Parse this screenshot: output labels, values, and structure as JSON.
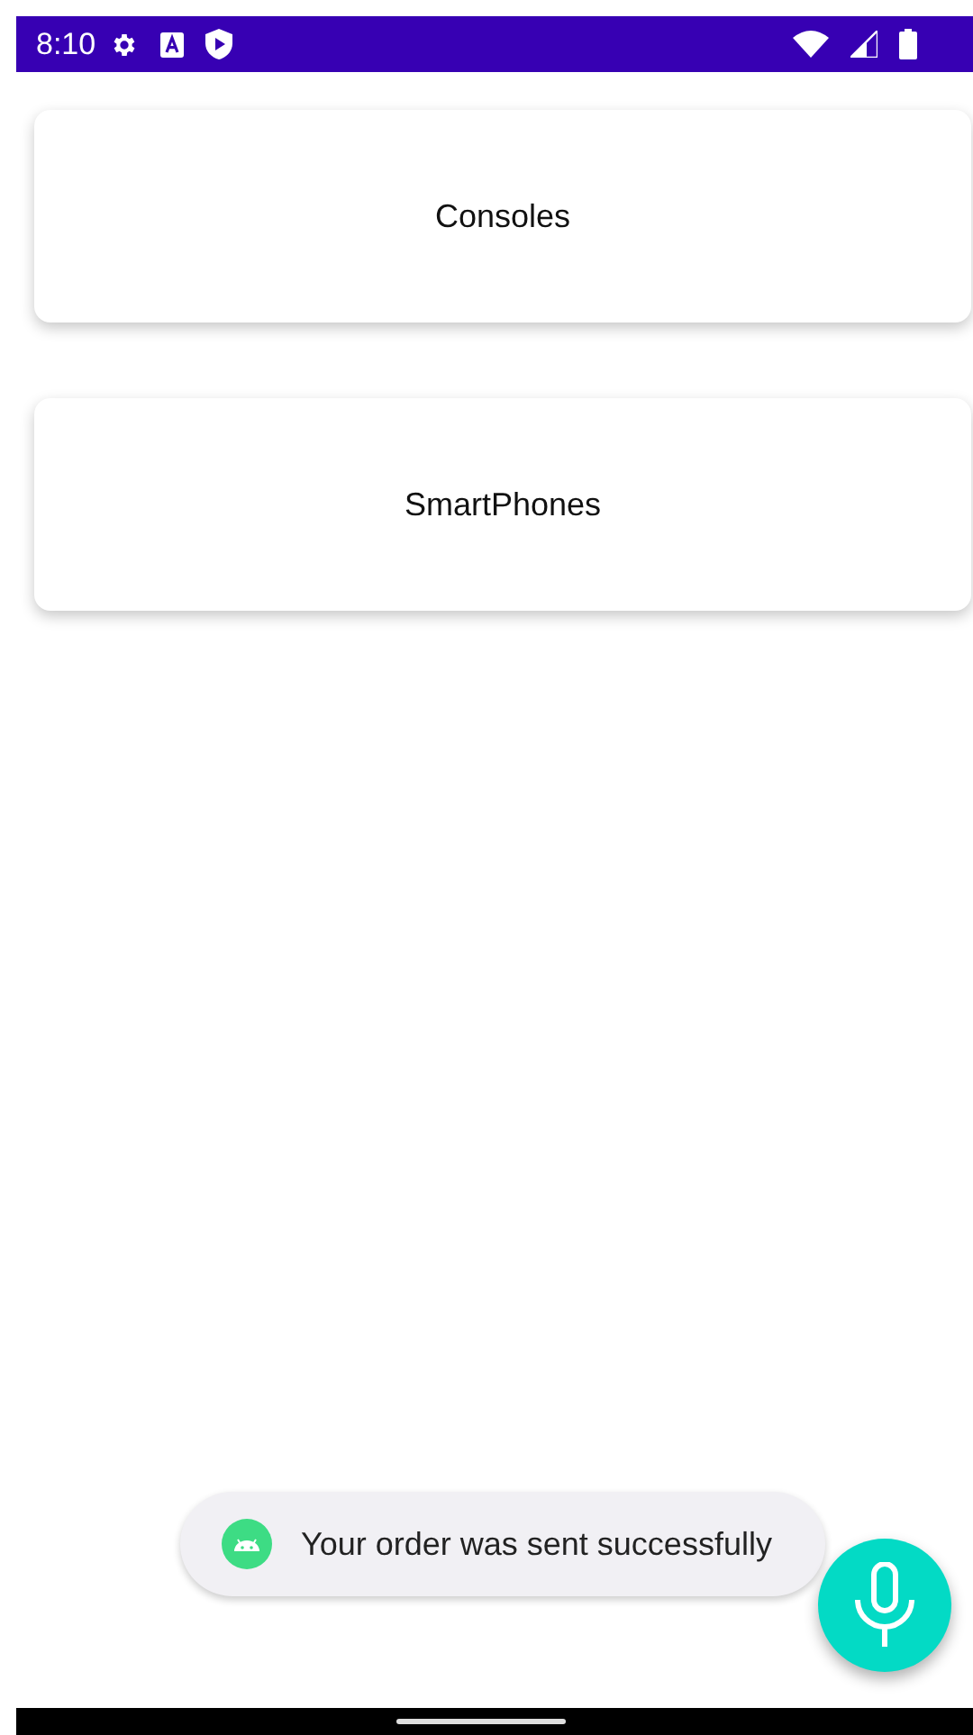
{
  "status_bar": {
    "time": "8:10"
  },
  "categories": [
    {
      "label": "Consoles"
    },
    {
      "label": "SmartPhones"
    }
  ],
  "toast": {
    "message": "Your order was sent successfully"
  }
}
